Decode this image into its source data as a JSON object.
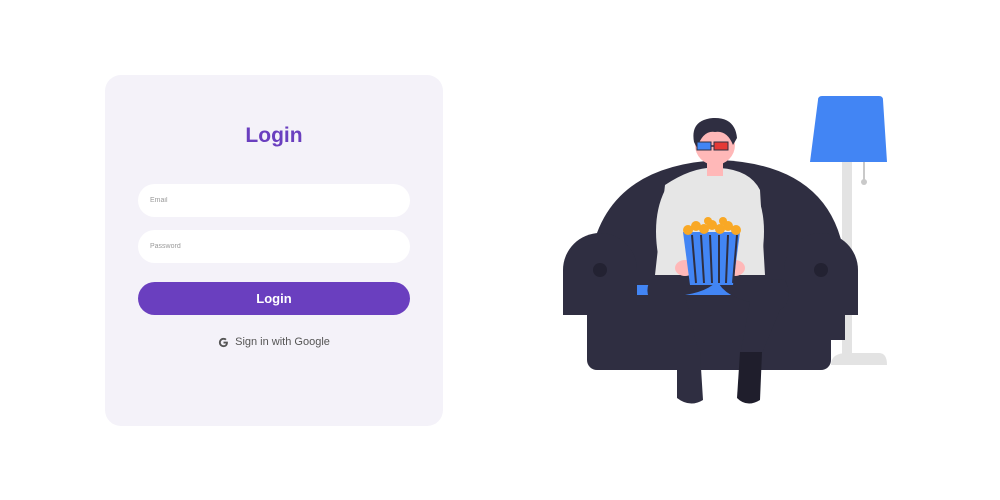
{
  "login": {
    "title": "Login",
    "email_placeholder": "Email",
    "password_placeholder": "Password",
    "submit_label": "Login",
    "google_label": "Sign in with Google",
    "google_icon": "google-g-icon"
  },
  "colors": {
    "accent": "#6a3fbf",
    "card_background": "#f4f2f9",
    "couch": "#2f2e41",
    "lamp_shade": "#4285f4"
  },
  "illustration": {
    "subject": "person-on-couch-with-popcorn-illustration"
  }
}
